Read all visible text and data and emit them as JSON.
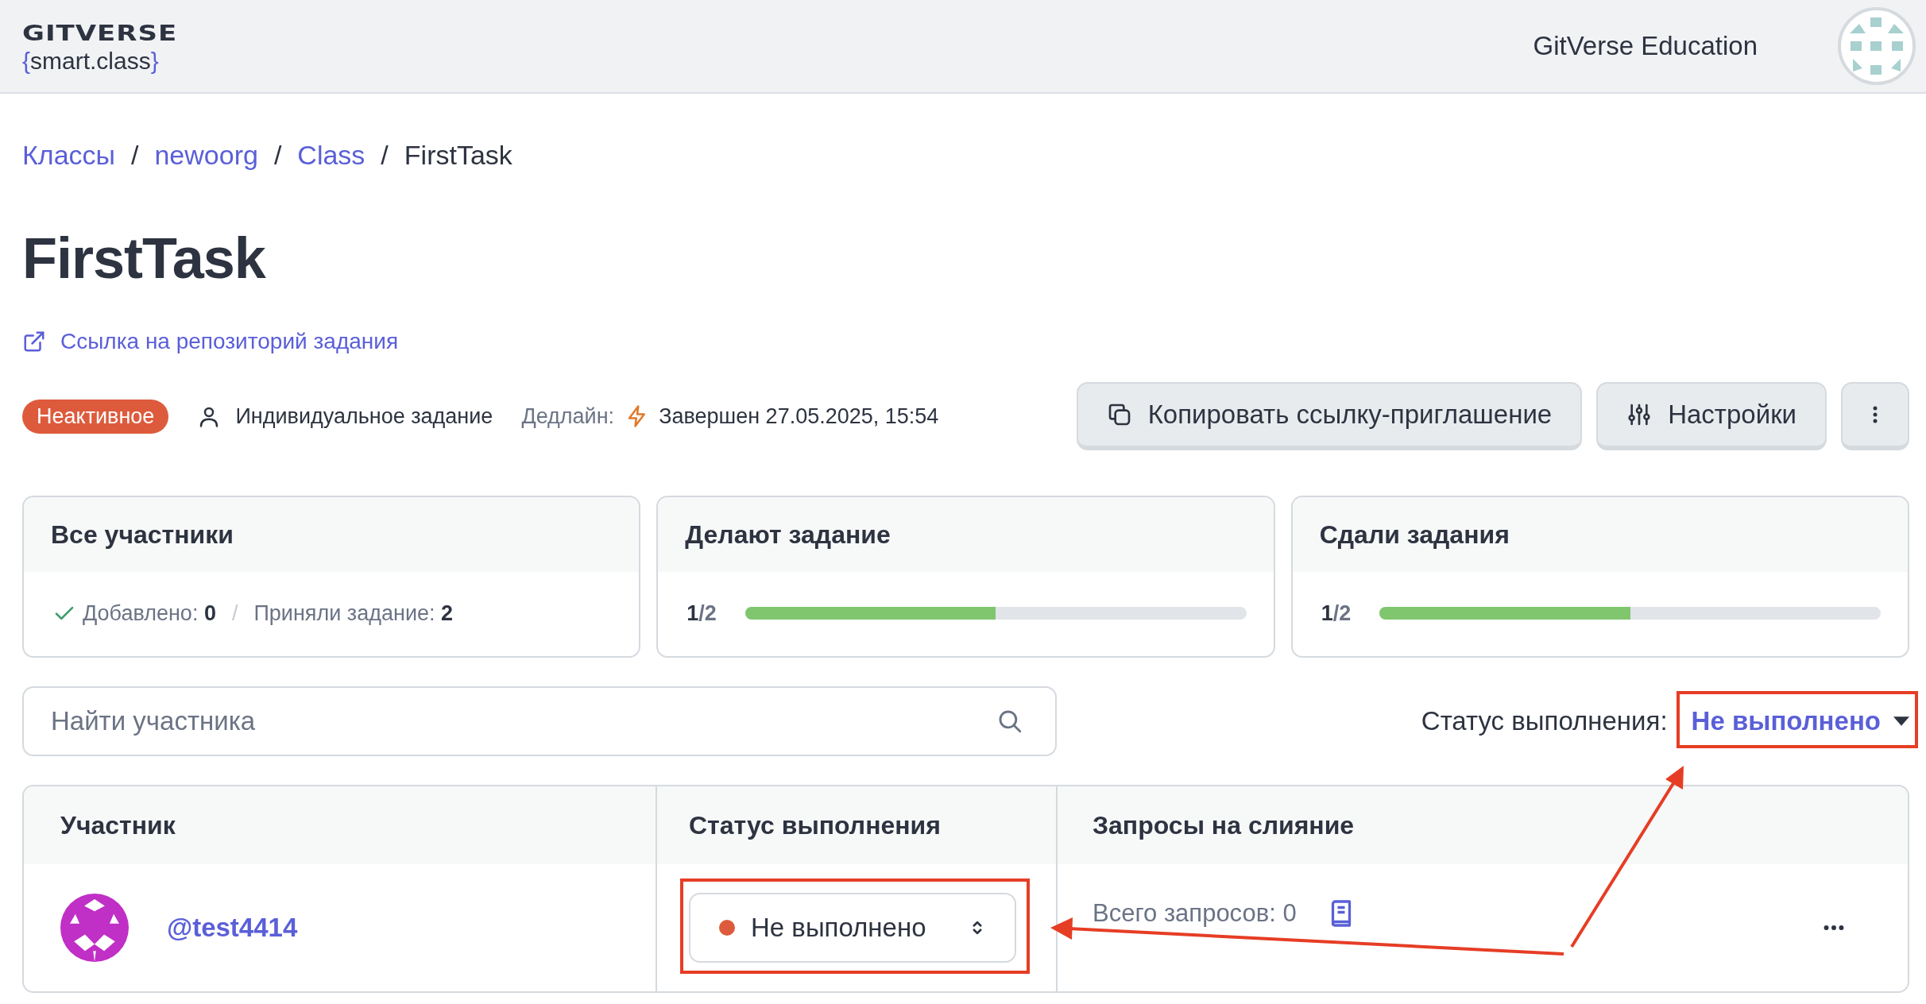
{
  "header": {
    "logo_word": "GITVERSE",
    "logo_brace_open": "{",
    "logo_sub": "smart.class",
    "logo_brace_close": "}",
    "org_name": "GitVerse Education"
  },
  "breadcrumbs": [
    {
      "label": "Классы",
      "kind": "link"
    },
    {
      "label": "/",
      "kind": "separator"
    },
    {
      "label": "newoorg",
      "kind": "link"
    },
    {
      "label": "/",
      "kind": "separator"
    },
    {
      "label": "Class",
      "kind": "link"
    },
    {
      "label": "/",
      "kind": "separator"
    },
    {
      "label": "FirstTask",
      "kind": "current"
    }
  ],
  "title": "FirstTask",
  "repo_link": "Ссылка на репозиторий задания",
  "meta": {
    "status_badge": "Неактивное",
    "assignment_type": "Индивидуальное задание",
    "deadline_label": "Дедлайн:",
    "deadline_value": "Завершен 27.05.2025, 15:54"
  },
  "actions": [
    {
      "label": "Копировать ссылку-приглашение",
      "kind": "copy"
    },
    {
      "label": "Настройки",
      "kind": "settings"
    },
    {
      "kind": "more"
    }
  ],
  "cards": [
    {
      "title": "Все участники",
      "kind": "counts",
      "items": [
        {
          "label": "Добавлено:",
          "value": "0"
        },
        {
          "label": "Приняли задание:",
          "value": "2"
        }
      ],
      "separator": "/"
    },
    {
      "title": "Делают задание",
      "kind": "progress",
      "done": "1",
      "rest": "/2",
      "level": 0.5
    },
    {
      "title": "Сдали задания",
      "kind": "progress",
      "done": "1",
      "rest": "/2",
      "level": 0.5
    }
  ],
  "search": {
    "placeholder": "Найти участника"
  },
  "filter": {
    "label": "Статус выполнения:",
    "value": "Не выполнено"
  },
  "table": {
    "columns": [
      "Участник",
      "Статус выполнения",
      "Запросы на слияние"
    ],
    "rows": [
      {
        "username": "@test4414",
        "status": "Не выполнено",
        "color": "#dd5b3c",
        "requests": "Всего запросов: 0"
      }
    ]
  }
}
